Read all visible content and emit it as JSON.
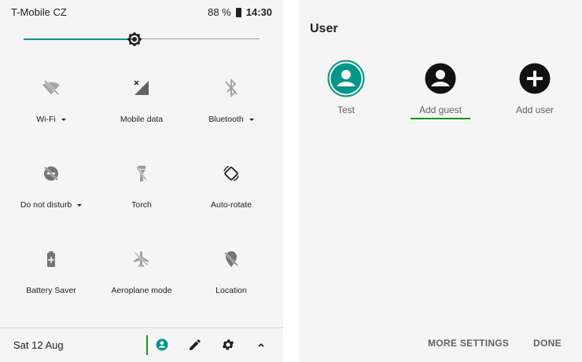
{
  "status_bar": {
    "carrier": "T-Mobile CZ",
    "battery_percent": "88 %",
    "time": "14:30"
  },
  "brightness": {
    "level_fraction": 0.47
  },
  "tiles": [
    {
      "label": "Wi-Fi",
      "icon": "wifi-off-icon",
      "has_dropdown": true
    },
    {
      "label": "Mobile data",
      "icon": "mobile-data-off-icon",
      "has_dropdown": false
    },
    {
      "label": "Bluetooth",
      "icon": "bluetooth-off-icon",
      "has_dropdown": true
    },
    {
      "label": "Do not disturb",
      "icon": "do-not-disturb-icon",
      "has_dropdown": true
    },
    {
      "label": "Torch",
      "icon": "torch-icon",
      "has_dropdown": false
    },
    {
      "label": "Auto-rotate",
      "icon": "auto-rotate-icon",
      "has_dropdown": false
    },
    {
      "label": "Battery Saver",
      "icon": "battery-saver-icon",
      "has_dropdown": false
    },
    {
      "label": "Aeroplane mode",
      "icon": "aeroplane-icon",
      "has_dropdown": false
    },
    {
      "label": "Location",
      "icon": "location-off-icon",
      "has_dropdown": false
    }
  ],
  "footer": {
    "date": "Sat 12 Aug",
    "icons": [
      "user-switch-icon",
      "edit-icon",
      "settings-icon",
      "collapse-icon"
    ]
  },
  "user_dialog": {
    "title": "User",
    "users": [
      {
        "label": "Test",
        "icon": "user-avatar-icon",
        "selected": true
      },
      {
        "label": "Add guest",
        "icon": "guest-avatar-icon",
        "focused": true
      },
      {
        "label": "Add user",
        "icon": "add-user-icon"
      }
    ],
    "more_settings_label": "MORE SETTINGS",
    "done_label": "DONE"
  },
  "colors": {
    "accent": "#009688",
    "focus": "#1a8f2a",
    "icon_disabled": "#9e9e9e",
    "icon_active": "#212121"
  }
}
